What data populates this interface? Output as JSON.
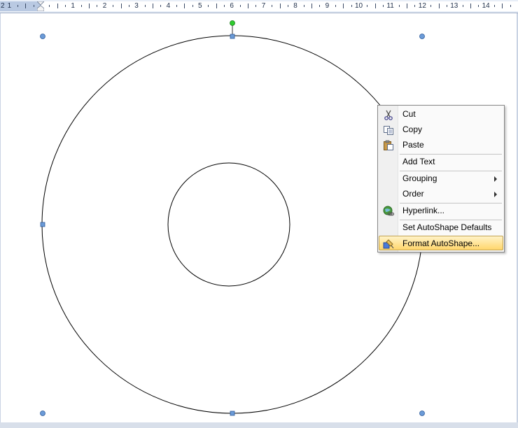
{
  "ruler": {
    "left_label": "2",
    "numbers": [
      "1",
      "1",
      "2",
      "3",
      "4",
      "5",
      "6",
      "7",
      "8",
      "9",
      "10",
      "11",
      "12",
      "13",
      "14"
    ]
  },
  "context_menu": {
    "items": [
      {
        "label": "Cut",
        "icon": "scissors-icon"
      },
      {
        "label": "Copy",
        "icon": "copy-icon"
      },
      {
        "label": "Paste",
        "icon": "paste-icon"
      },
      {
        "label": "Add Text"
      },
      {
        "label": "Grouping",
        "submenu": true
      },
      {
        "label": "Order",
        "submenu": true
      },
      {
        "label": "Hyperlink...",
        "icon": "hyperlink-icon"
      },
      {
        "label": "Set AutoShape Defaults"
      },
      {
        "label": "Format AutoShape...",
        "icon": "format-autoshape-icon",
        "highlighted": true
      }
    ]
  },
  "colors": {
    "selection_handle": "#6b9bd8",
    "rotation_handle": "#2ecc2e",
    "menu_highlight": "#ffd66c"
  }
}
